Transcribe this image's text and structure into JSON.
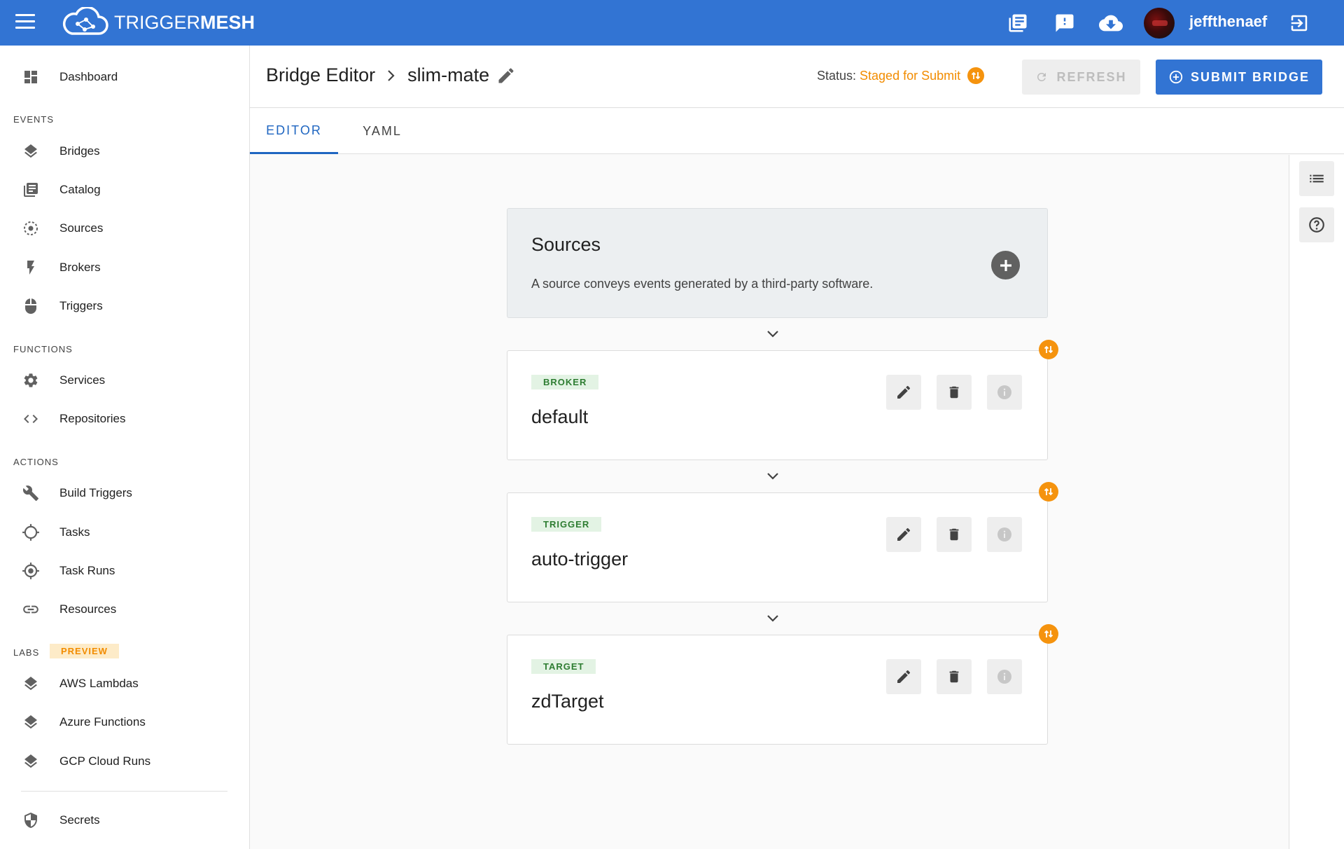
{
  "topbar": {
    "logo": {
      "light": "TRIGGER",
      "bold": "MESH"
    },
    "icons": [
      "docs-icon",
      "feedback-icon",
      "download-cloud-icon"
    ],
    "username": "jeffthenaef",
    "color": "#3274d3"
  },
  "sidebar": {
    "dashboard": "Dashboard",
    "sections": {
      "events": "EVENTS",
      "functions": "FUNCTIONS",
      "actions": "ACTIONS",
      "labs": "LABS",
      "preview": "PREVIEW"
    },
    "events": [
      "Bridges",
      "Catalog",
      "Sources",
      "Brokers",
      "Triggers"
    ],
    "functions": [
      "Services",
      "Repositories"
    ],
    "actions": [
      "Build Triggers",
      "Tasks",
      "Task Runs",
      "Resources"
    ],
    "labs": [
      "AWS Lambdas",
      "Azure Functions",
      "GCP Cloud Runs"
    ],
    "secrets": "Secrets"
  },
  "header": {
    "breadcrumb_root": "Bridge Editor",
    "bridge_name": "slim-mate",
    "status_label": "Status:",
    "status_value": "Staged for Submit",
    "refresh_label": "REFRESH",
    "submit_label": "SUBMIT BRIDGE"
  },
  "tabs": [
    {
      "label": "EDITOR",
      "active": true
    },
    {
      "label": "YAML",
      "active": false
    }
  ],
  "sources": {
    "title": "Sources",
    "description": "A source conveys events generated by a third-party software."
  },
  "components": [
    {
      "tag": "BROKER",
      "name": "default"
    },
    {
      "tag": "TRIGGER",
      "name": "auto-trigger"
    },
    {
      "tag": "TARGET",
      "name": "zdTarget"
    }
  ],
  "colors": {
    "accent": "#3274d3",
    "status": "#f28c00",
    "tag_bg": "#e3f3e4",
    "tag_fg": "#2e7d32"
  }
}
